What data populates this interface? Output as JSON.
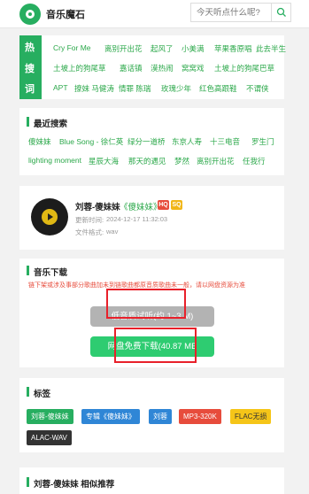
{
  "header": {
    "title": "音乐魔石",
    "search_placeholder": "今天听点什么呢?"
  },
  "hot": {
    "label_chars": [
      "热",
      "搜",
      "词"
    ],
    "rows": [
      [
        "Cry For Me",
        "离别开出花",
        "起风了",
        "小美满",
        "苹果香原唱",
        "此去半生"
      ],
      [
        "土坡上的狗尾草",
        "嘉话镇",
        "漠热闹",
        "窝窝戏",
        "土坡上的狗尾巴草"
      ],
      [
        "APT",
        "撩妹 马健涛",
        "情罪 陈瑞",
        "玫瑰少年",
        "红色高跟鞋",
        "不谓侠"
      ]
    ]
  },
  "recent": {
    "title": "最近搜索",
    "rows": [
      [
        "傻妹妹",
        "Blue Song - 徐仁英",
        "绿分一道桥",
        "东京人寿",
        "十三电音",
        "罗生门"
      ],
      [
        "lighting moment",
        "星辰大海",
        "那天的遇见",
        "梦然",
        "离别开出花",
        "任我行"
      ]
    ]
  },
  "song": {
    "name": "刘蓉-傻妹妹",
    "album": "《傻妹妹》",
    "badges": [
      {
        "text": "HQ",
        "color": "#e74c3c"
      },
      {
        "text": "SQ",
        "color": "#f1b617"
      }
    ],
    "update_label": "更新时间:",
    "update_value": "2024-12-17 11:32:03",
    "format_label": "文件格式:",
    "format_value": "wav"
  },
  "download": {
    "title": "音乐下载",
    "notice": "链下架或涉及事部分歌曲加未到链歌曲都原音质歌曲未一般，请以网盘资源为准",
    "low_quality_label": "低音质试听(约 1~3 M)",
    "free_download_label": "网盘免费下载(40.87 MB"
  },
  "tags": {
    "title": "标签",
    "items": [
      {
        "text": "刘蓉-傻妹妹",
        "bg": "#27ae60",
        "fg": "#ffffff"
      },
      {
        "text": "专辑《傻妹妹》",
        "bg": "#2f86d6",
        "fg": "#ffffff"
      },
      {
        "text": "刘蓉",
        "bg": "#2f86d6",
        "fg": "#ffffff"
      },
      {
        "text": "MP3-320K",
        "bg": "#e74c3c",
        "fg": "#ffffff"
      },
      {
        "text": "FLAC无损",
        "bg": "#f5c518",
        "fg": "#333333"
      },
      {
        "text": "ALAC-WAV",
        "bg": "#333333",
        "fg": "#ffffff"
      }
    ]
  },
  "similar": {
    "title": "刘蓉-傻妹妹 相似推荐"
  },
  "colors": {
    "accent": "#27ae60",
    "highlight_box": "#e8202a"
  }
}
